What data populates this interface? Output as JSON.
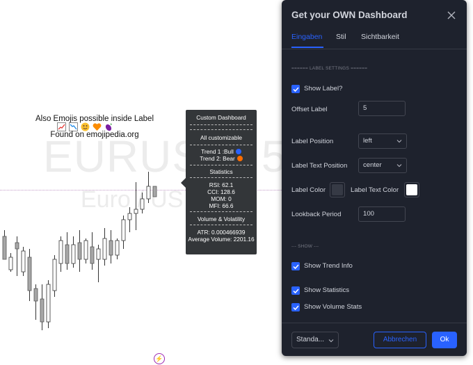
{
  "chart": {
    "watermark_symbol": "EURUSD, 5",
    "watermark_name": "Euro / US",
    "emoji_label_line1": "Also Emojis possible inside Label",
    "emoji_label_line2": "Found on emojipedia.org",
    "emojis": [
      "chart-increasing-icon",
      "chart-decreasing-icon",
      "smiley-icon",
      "heart-icon",
      "eggplant-icon"
    ],
    "candles": [
      {
        "o": 0.31,
        "h": 0.34,
        "l": 0.2,
        "c": 0.2
      },
      {
        "o": 0.15,
        "h": 0.23,
        "l": 0.14,
        "c": 0.21
      },
      {
        "o": 0.28,
        "h": 0.31,
        "l": 0.12,
        "c": 0.25
      },
      {
        "o": 0.14,
        "h": 0.26,
        "l": 0.12,
        "c": 0.24
      },
      {
        "o": 0.21,
        "h": 0.25,
        "l": 0.0,
        "c": 0.05
      },
      {
        "o": 0.06,
        "h": 0.08,
        "l": -0.09,
        "c": 0.0
      },
      {
        "o": 0.01,
        "h": 0.08,
        "l": -0.14,
        "c": -0.1
      },
      {
        "o": -0.1,
        "h": 0.1,
        "l": -0.13,
        "c": 0.08
      },
      {
        "o": 0.05,
        "h": 0.22,
        "l": 0.02,
        "c": 0.2
      },
      {
        "o": 0.18,
        "h": 0.31,
        "l": 0.14,
        "c": 0.29
      },
      {
        "o": 0.27,
        "h": 0.33,
        "l": 0.15,
        "c": 0.18
      },
      {
        "o": 0.18,
        "h": 0.31,
        "l": 0.16,
        "c": 0.27
      },
      {
        "o": 0.28,
        "h": 0.34,
        "l": 0.14,
        "c": 0.2
      },
      {
        "o": 0.2,
        "h": 0.3,
        "l": 0.18,
        "c": 0.29
      },
      {
        "o": 0.26,
        "h": 0.33,
        "l": 0.15,
        "c": 0.18
      },
      {
        "o": 0.2,
        "h": 0.27,
        "l": 0.09,
        "c": 0.25
      },
      {
        "o": 0.2,
        "h": 0.35,
        "l": 0.17,
        "c": 0.3
      },
      {
        "o": 0.29,
        "h": 0.34,
        "l": 0.18,
        "c": 0.22
      },
      {
        "o": 0.22,
        "h": 0.3,
        "l": 0.2,
        "c": 0.29
      },
      {
        "o": 0.29,
        "h": 0.41,
        "l": 0.25,
        "c": 0.39
      },
      {
        "o": 0.39,
        "h": 0.45,
        "l": 0.33,
        "c": 0.42
      },
      {
        "o": 0.42,
        "h": 0.57,
        "l": 0.34,
        "c": 0.44
      },
      {
        "o": 0.44,
        "h": 0.52,
        "l": 0.42,
        "c": 0.49
      },
      {
        "o": 0.49,
        "h": 0.62,
        "l": 0.47,
        "c": 0.55
      },
      {
        "o": 0.55,
        "h": 0.55,
        "l": 0.5,
        "c": 0.5
      }
    ]
  },
  "info_label": {
    "title": "Custom Dashboard",
    "customizable": "All customizable",
    "trend1": "Trend 1 :Bull",
    "trend2": "Trend 2: Bear",
    "trend1_color": "#2962ff",
    "trend2_color": "#ff6d00",
    "stats_header": "Statistics",
    "rsi": "RSI: 62.1",
    "cci": "CCI: 128.6",
    "mom": "MOM: 0",
    "mfi": "MFI: 66.6",
    "vol_header": "Volume & Volatility",
    "atr": "ATR: 0.000466939",
    "avg_volume": "Average Volume: 2201.16"
  },
  "dialog": {
    "title": "Get your OWN Dashboard",
    "tabs": [
      "Eingaben",
      "Stil",
      "Sichtbarkeit"
    ],
    "section_label": "====== LABEL SETTINGS ======",
    "show_label": "Show Label?",
    "offset_label": "Offset Label",
    "offset_value": "5",
    "label_position": "Label Position",
    "label_position_value": "left",
    "label_text_position": "Label Text Position",
    "label_text_position_value": "center",
    "label_color": "Label Color",
    "label_color_value": "#363a45",
    "label_text_color": "Label Text Color",
    "label_text_color_value": "#ffffff",
    "lookback_period": "Lookback Period",
    "lookback_value": "100",
    "section_show": "--- SHOW ---",
    "show_trend": "Show Trend Info",
    "show_statistics": "Show Statistics",
    "show_volume": "Show Volume Stats",
    "template_button": "Standa...",
    "cancel_button": "Abbrechen",
    "ok_button": "Ok"
  }
}
